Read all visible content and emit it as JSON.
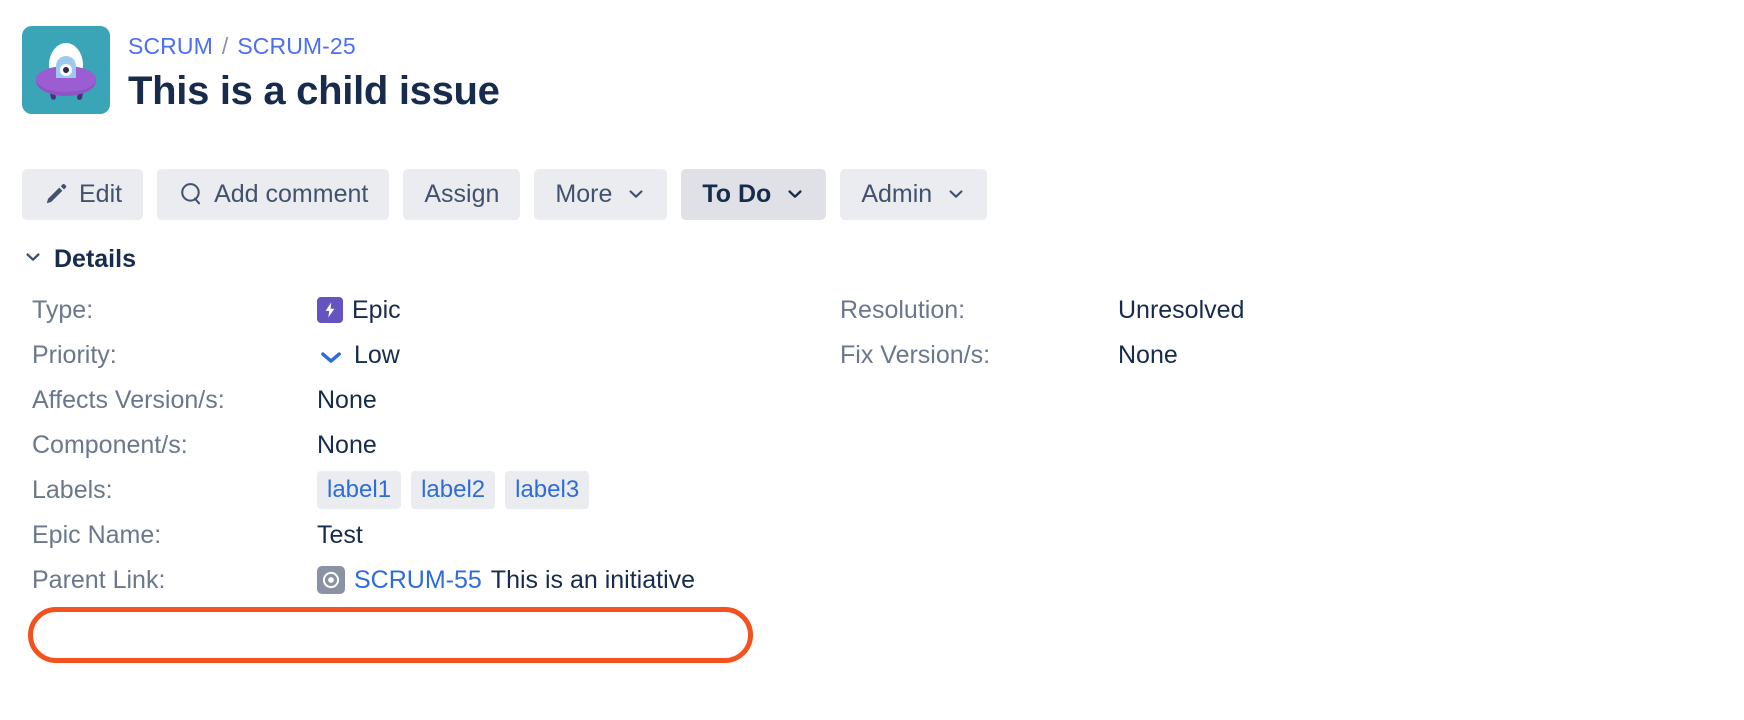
{
  "header": {
    "avatar_name": "project-avatar-ufo",
    "avatar_bg": "#3BA5B8",
    "breadcrumb": {
      "project": "SCRUM",
      "separator": "/",
      "issue_key": "SCRUM-25"
    },
    "title": "This is a child issue"
  },
  "toolbar": {
    "edit_label": "Edit",
    "add_comment_label": "Add comment",
    "assign_label": "Assign",
    "more_label": "More",
    "status_label": "To Do",
    "admin_label": "Admin"
  },
  "details": {
    "section_title": "Details",
    "left_fields": [
      {
        "label": "Type:",
        "value": "Epic",
        "icon": "epic-icon"
      },
      {
        "label": "Priority:",
        "value": "Low",
        "icon": "priority-low-icon"
      },
      {
        "label": "Affects Version/s:",
        "value": "None",
        "icon": ""
      },
      {
        "label": "Component/s:",
        "value": "None",
        "icon": ""
      },
      {
        "label": "Labels:",
        "value": "",
        "icon": ""
      },
      {
        "label": "Epic Name:",
        "value": "Test",
        "icon": ""
      },
      {
        "label": "Parent Link:",
        "value": "",
        "icon": "initiative-icon"
      }
    ],
    "right_fields": [
      {
        "label": "Resolution:",
        "value": "Unresolved"
      },
      {
        "label": "Fix Version/s:",
        "value": "None"
      }
    ],
    "labels": [
      "label1",
      "label2",
      "label3"
    ],
    "parent_link": {
      "key": "SCRUM-55",
      "summary": "This is an initiative"
    }
  },
  "annotation": {
    "shape": "ellipse",
    "color": "#F4511E",
    "target": "Parent Link:"
  },
  "colors": {
    "link": "#2D6CDF",
    "breadcrumb_link": "#4C6EF5",
    "text": "#172B4D",
    "muted_text": "#6B778C",
    "button_bg": "#EBECF0",
    "button_bg_active": "#DFE1E6",
    "epic_purple": "#6554C0",
    "annotation_red": "#F4511E"
  }
}
